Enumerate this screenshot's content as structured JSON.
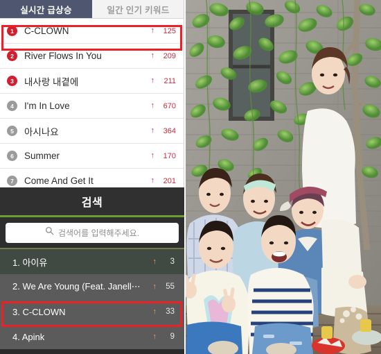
{
  "realtime_panel": {
    "tabs": [
      {
        "label": "실시간 급상승",
        "active": true
      },
      {
        "label": "일간 인기 키워드",
        "active": false
      }
    ],
    "rows": [
      {
        "rank": "1",
        "title": "C-CLOWN",
        "arrow": "up-arrow-icon",
        "arrow_glyph": "↑",
        "count": "125",
        "badge": "hot"
      },
      {
        "rank": "2",
        "title": "River Flows In You",
        "arrow": "up-arrow-icon",
        "arrow_glyph": "↑",
        "count": "209",
        "badge": "hot"
      },
      {
        "rank": "3",
        "title": "내사랑 내곁에",
        "arrow": "up-arrow-icon",
        "arrow_glyph": "↑",
        "count": "211",
        "badge": "hot"
      },
      {
        "rank": "4",
        "title": "I'm In Love",
        "arrow": "up-arrow-icon",
        "arrow_glyph": "↑",
        "count": "670",
        "badge": "cold"
      },
      {
        "rank": "5",
        "title": "아시나요",
        "arrow": "up-arrow-icon",
        "arrow_glyph": "↑",
        "count": "364",
        "badge": "cold"
      },
      {
        "rank": "6",
        "title": "Summer",
        "arrow": "up-arrow-icon",
        "arrow_glyph": "↑",
        "count": "170",
        "badge": "cold"
      },
      {
        "rank": "7",
        "title": "Come And Get It",
        "arrow": "up-arrow-icon",
        "arrow_glyph": "↑",
        "count": "201",
        "badge": "cold"
      }
    ],
    "highlight_row_index": 0,
    "highlight_color": "#ec2027"
  },
  "search_panel": {
    "title": "검색",
    "accent_color": "#6f9c33",
    "search": {
      "icon": "search-icon",
      "placeholder": "검색어를 입력해주세요.",
      "value": ""
    },
    "results": [
      {
        "label": "1. 아이유",
        "arrow_glyph": "↑",
        "count": "3"
      },
      {
        "label": "2. We Are Young (Feat. Janell⋯",
        "arrow_glyph": "↑",
        "count": "55"
      },
      {
        "label": "3. C-CLOWN",
        "arrow_glyph": "↑",
        "count": "33"
      },
      {
        "label": "4. Apink",
        "arrow_glyph": "↑",
        "count": "9"
      }
    ],
    "highlight_row_index": 2,
    "highlight_color": "#ec2027"
  },
  "photo": {
    "alt": "boy group of six members posing outdoors in front of a gray brick wall with green vines"
  }
}
